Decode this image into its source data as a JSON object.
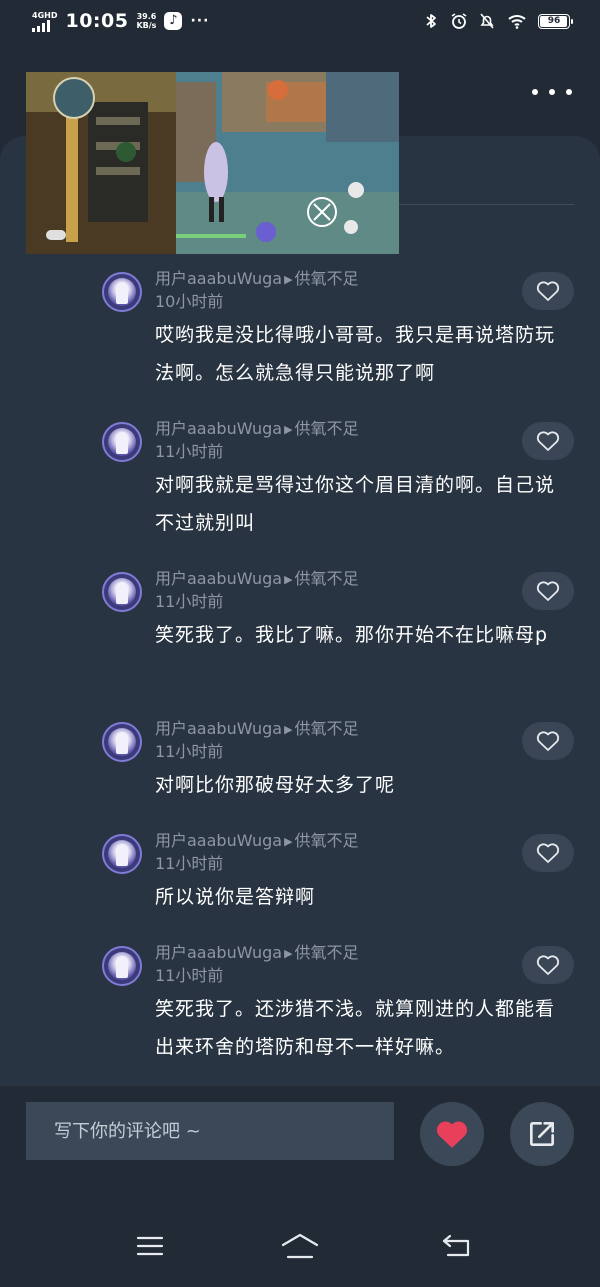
{
  "status_bar": {
    "network_type": "4GHD",
    "time": "10:05",
    "net_speed_value": "39.6",
    "net_speed_unit": "KB/s",
    "more_indicator": "···",
    "battery_level": "96"
  },
  "input": {
    "placeholder": "写下你的评论吧 ~"
  },
  "colors": {
    "background": "#222b35",
    "sheet": "#283441",
    "meta_text": "#8d97a4",
    "like_heart": "#e8405a"
  },
  "comments": [
    {
      "user": "用户aaabuWuga",
      "level": "供氧不足",
      "time": "10小时前",
      "text": "哎哟我是没比得哦小哥哥。我只是再说塔防玩法啊。怎么就急得只能说那了啊"
    },
    {
      "user": "用户aaabuWuga",
      "level": "供氧不足",
      "time": "11小时前",
      "text": "对啊我就是骂得过你这个眉目清的啊。自己说不过就别叫"
    },
    {
      "user": "用户aaabuWuga",
      "level": "供氧不足",
      "time": "11小时前",
      "text": "笑死我了。我比了嘛。那你开始不在比嘛母p"
    },
    {
      "user": "用户aaabuWuga",
      "level": "供氧不足",
      "time": "11小时前",
      "text": "对啊比你那破母好太多了呢"
    },
    {
      "user": "用户aaabuWuga",
      "level": "供氧不足",
      "time": "11小时前",
      "text": "所以说你是答辩啊"
    },
    {
      "user": "用户aaabuWuga",
      "level": "供氧不足",
      "time": "11小时前",
      "text": "笑死我了。还涉猎不浅。就算刚进的人都能看出来环舍的塔防和母不一样好嘛。"
    }
  ]
}
